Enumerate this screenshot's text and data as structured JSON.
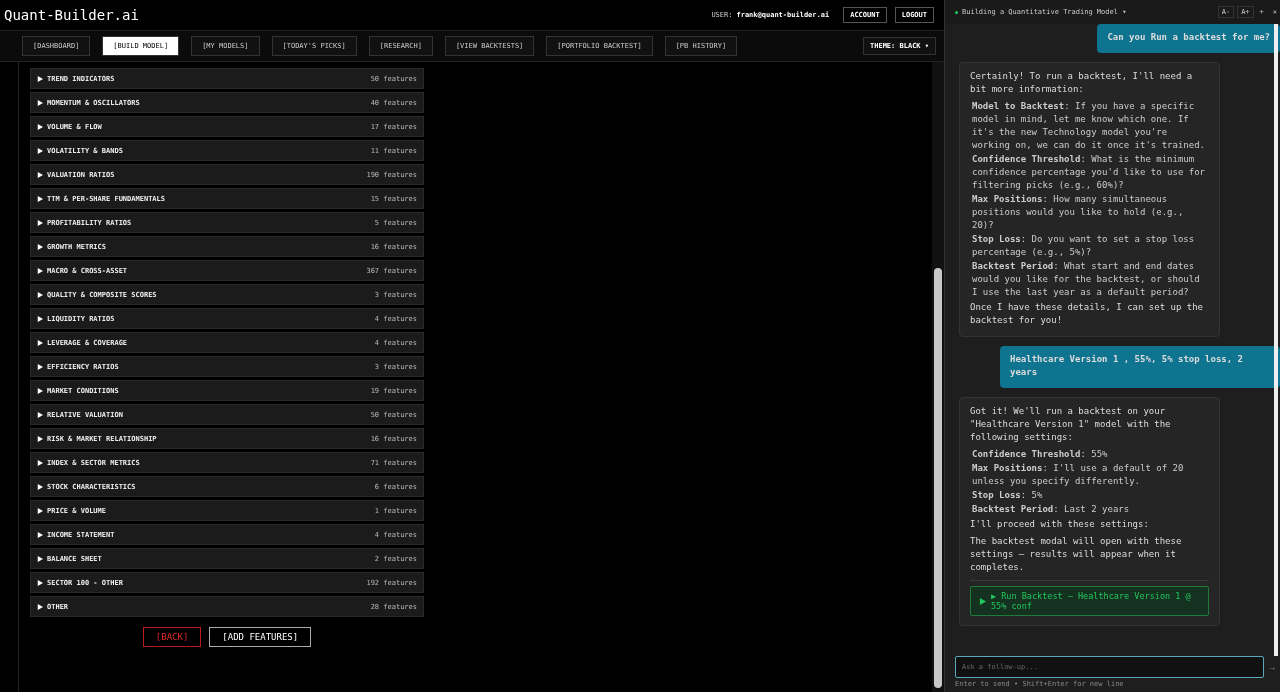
{
  "header": {
    "logo": "Quant-Builder.ai",
    "user_label": "USER:",
    "user_email": "frank@quant-builder.ai",
    "buttons": [
      "ACCOUNT",
      "LOGOUT"
    ]
  },
  "nav": {
    "tabs": [
      {
        "label": "[DASHBOARD]",
        "selected": false
      },
      {
        "label": "[BUILD MODEL]",
        "selected": true
      },
      {
        "label": "[MY MODELS]",
        "selected": false
      },
      {
        "label": "[TODAY'S PICKS]",
        "selected": false
      },
      {
        "label": "[RESEARCH]",
        "selected": false
      },
      {
        "label": "[VIEW BACKTESTS]",
        "selected": false
      },
      {
        "label": "[PORTFOLIO BACKTEST]",
        "selected": false
      },
      {
        "label": "[PB HISTORY]",
        "selected": false
      }
    ],
    "theme": "THEME: BLACK ▾"
  },
  "feature_groups": [
    {
      "label": "TREND INDICATORS",
      "count": "50 features",
      "expanded": false
    },
    {
      "label": "MOMENTUM & OSCILLATORS",
      "count": "40 features",
      "expanded": false
    },
    {
      "label": "VOLUME & FLOW",
      "count": "17 features",
      "expanded": false
    },
    {
      "label": "VOLATILITY & BANDS",
      "count": "11 features",
      "expanded": false
    },
    {
      "label": "VALUATION RATIOS",
      "count": "190 features",
      "expanded": false
    },
    {
      "label": "TTM & PER-SHARE FUNDAMENTALS",
      "count": "15 features",
      "expanded": false
    },
    {
      "label": "PROFITABILITY RATIOS",
      "count": "5 features",
      "expanded": false
    },
    {
      "label": "GROWTH METRICS",
      "count": "16 features",
      "expanded": false
    },
    {
      "label": "MACRO & CROSS-ASSET",
      "count": "367 features",
      "expanded": false
    },
    {
      "label": "QUALITY & COMPOSITE SCORES",
      "count": "3 features",
      "expanded": false
    },
    {
      "label": "LIQUIDITY RATIOS",
      "count": "4 features",
      "expanded": false
    },
    {
      "label": "LEVERAGE & COVERAGE",
      "count": "4 features",
      "expanded": false
    },
    {
      "label": "EFFICIENCY RATIOS",
      "count": "3 features",
      "expanded": false
    },
    {
      "label": "MARKET CONDITIONS",
      "count": "19 features",
      "expanded": false
    },
    {
      "label": "RELATIVE VALUATION",
      "count": "50 features",
      "expanded": false
    },
    {
      "label": "RISK & MARKET RELATIONSHIP",
      "count": "16 features",
      "expanded": false
    },
    {
      "label": "INDEX & SECTOR METRICS",
      "count": "71 features",
      "expanded": false
    },
    {
      "label": "STOCK CHARACTERISTICS",
      "count": "6 features",
      "expanded": false
    },
    {
      "label": "PRICE & VOLUME",
      "count": "1 features",
      "expanded": false
    },
    {
      "label": "INCOME STATEMENT",
      "count": "4 features",
      "expanded": false
    },
    {
      "label": "BALANCE SHEET",
      "count": "2 features",
      "expanded": false
    },
    {
      "label": "SECTOR 100 - OTHER",
      "count": "192 features",
      "expanded": false
    },
    {
      "label": "OTHER",
      "count": "28 features",
      "expanded": false
    }
  ],
  "actions": [
    {
      "label": "[BACK]",
      "kind": "danger"
    },
    {
      "label": "[ADD FEATURES]",
      "kind": "primary"
    }
  ],
  "chat": {
    "title": "Building a Quantitative Trading Model ▾",
    "controls": [
      "A-",
      "A+",
      "+",
      "×"
    ],
    "messages": [
      {
        "kind": "user",
        "paragraphs": [
          "Can you Run a backtest for me?"
        ]
      },
      {
        "kind": "assistant",
        "paragraphs": [
          "Certainly! To run a backtest, I'll need a bit more information:"
        ],
        "items": [
          "**Model to Backtest**: If you have a specific model in mind, let me know which one. If it's the new Technology model you're working on, we can do it once it's trained.",
          "**Confidence Threshold**: What is the minimum confidence percentage you'd like to use for filtering picks (e.g., 60%)?",
          "**Max Positions**: How many simultaneous positions would you like to hold (e.g., 20)?",
          "**Stop Loss**: Do you want to set a stop loss percentage (e.g., 5%)?",
          "**Backtest Period**: What start and end dates would you like for the backtest, or should I use the last year as a default period?"
        ],
        "closing": [
          "Once I have these details, I can set up the backtest for you!"
        ]
      },
      {
        "kind": "user",
        "paragraphs": [
          "Healthcare Version 1 , 55%, 5% stop loss, 2 years"
        ]
      },
      {
        "kind": "assistant",
        "paragraphs": [
          "Got it! We'll run a backtest on your \"Healthcare Version 1\" model with the following settings:"
        ],
        "items": [
          "**Confidence Threshold**: 55%",
          "**Max Positions**: I'll use a default of 20 unless you specify differently.",
          "**Stop Loss**: 5%",
          "**Backtest Period**: Last 2 years"
        ],
        "closing": [
          "I'll proceed with these settings:",
          "The backtest modal will open with these settings — results will appear when it completes."
        ],
        "action": "▶ Run Backtest — Healthcare Version 1 @ 55% conf"
      }
    ],
    "input": {
      "placeholder": "Ask a follow-up...",
      "send": "→",
      "hint": "Enter to send • Shift+Enter for new line"
    }
  }
}
